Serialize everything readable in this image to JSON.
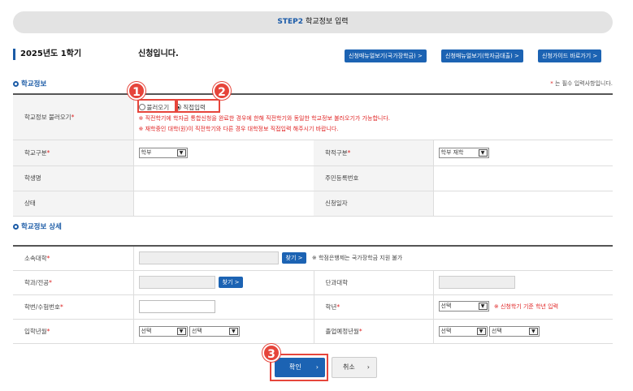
{
  "step_bar": {
    "step_code": "STEP2",
    "title": "학교정보 입력"
  },
  "header": {
    "semester": "2025년도 1학기",
    "applying_text": "신청입니다.",
    "buttons": [
      "신청매뉴얼보기(국가장학금) >",
      "신청매뉴얼보기(학자금대출) >",
      "신청가이드 바로가기 >"
    ]
  },
  "school_info": {
    "section_title": "학교정보",
    "required_note": "는 필수 입력사항입니다.",
    "load_label": "학교정보 불러오기",
    "radio_load": "불러오기",
    "radio_direct": "직접입력",
    "notice1": "※ 직전학기에 학자금 통합신청을 완료한 경우에 한해 직전학기와 동일한 학교정보 불러오기가 가능합니다.",
    "notice2": "※ 재학중인 대학(원)이 직전학기와 다른 경우 대학정보 직접입력 해주시기 바랍니다.",
    "school_type_label": "학교구분",
    "school_type_value": "학부",
    "enroll_status_label": "학적구분",
    "enroll_status_value": "학부 재학",
    "student_name_label": "학생명",
    "resident_no_label": "주민등록번호",
    "status_label": "상태",
    "apply_date_label": "신청일자"
  },
  "school_detail": {
    "section_title": "학교정보 상세",
    "univ_label": "소속대학",
    "find_label": "찾기",
    "univ_note": "※ 학점은행제는 국가장학금 지원 불가",
    "major_label": "학과/전공",
    "college_label": "단과대학",
    "student_no_label": "학번/수험번호",
    "grade_label": "학년",
    "select_placeholder": "선택",
    "grade_note": "※ 신청학기 기준 학년 입력",
    "admission_label": "입학년월",
    "graduation_label": "졸업예정년월"
  },
  "annotations": {
    "marker1": "1",
    "marker2": "2",
    "marker3": "3"
  },
  "footer": {
    "confirm_label": "확인",
    "cancel_label": "취소"
  },
  "colors": {
    "brand_blue": "#1c63b3",
    "highlight_red": "#e6453b",
    "notice_red": "#e02424"
  }
}
